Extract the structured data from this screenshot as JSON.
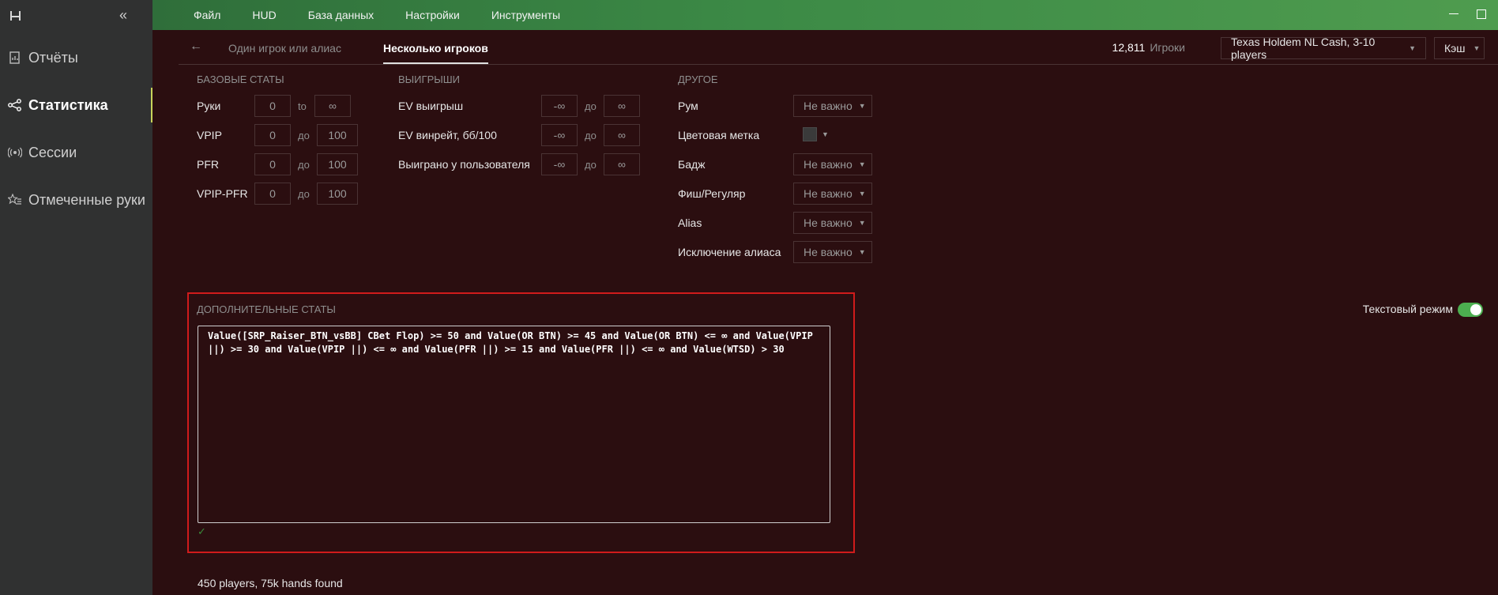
{
  "sidebar": {
    "logo_icon": "app-logo-icon",
    "collapse_icon": "chevrons-left-icon",
    "items": [
      {
        "label": "Отчёты",
        "icon": "report-icon"
      },
      {
        "label": "Статистика",
        "icon": "share-graph-icon"
      },
      {
        "label": "Сессии",
        "icon": "broadcast-icon"
      },
      {
        "label": "Отмеченные руки",
        "icon": "star-list-icon"
      }
    ]
  },
  "topbar": {
    "menu": [
      "Файл",
      "HUD",
      "База данных",
      "Настройки",
      "Инструменты"
    ]
  },
  "tabs": {
    "inactive": "Один игрок или алиас",
    "active": "Несколько игроков"
  },
  "header": {
    "count": "12,811",
    "count_label": "Игроки",
    "game_type": "Texas Holdem NL Cash, 3-10 players",
    "cash": "Кэш"
  },
  "basic_stats": {
    "title": "Базовые статы",
    "rows": [
      {
        "label": "Руки",
        "min": "0",
        "sep": "to",
        "max": "∞"
      },
      {
        "label": "VPIP",
        "min": "0",
        "sep": "до",
        "max": "100"
      },
      {
        "label": "PFR",
        "min": "0",
        "sep": "до",
        "max": "100"
      },
      {
        "label": "VPIP-PFR",
        "min": "0",
        "sep": "до",
        "max": "100"
      }
    ]
  },
  "winnings": {
    "title": "Выигрыши",
    "rows": [
      {
        "label": "EV выигрыш",
        "min": "-∞",
        "sep": "до",
        "max": "∞"
      },
      {
        "label": "EV винрейт, бб/100",
        "min": "-∞",
        "sep": "до",
        "max": "∞"
      },
      {
        "label": "Выиграно у пользователя",
        "min": "-∞",
        "sep": "до",
        "max": "∞"
      }
    ]
  },
  "other": {
    "title": "Другое",
    "rows": [
      {
        "label": "Рум",
        "value": "Не важно"
      },
      {
        "label": "Цветовая метка",
        "value": ""
      },
      {
        "label": "Бадж",
        "value": "Не важно"
      },
      {
        "label": "Фиш/Регуляр",
        "value": "Не важно"
      },
      {
        "label": "Alias",
        "value": "Не важно"
      },
      {
        "label": "Исключение алиаса",
        "value": "Не важно"
      }
    ]
  },
  "extra": {
    "title": "Дополнительные статы",
    "expression": "Value([SRP_Raiser_BTN_vsBB] CBet Flop) >= 50 and Value(OR BTN) >= 45 and Value(OR BTN) <= ∞ and Value(VPIP ||) >= 30 and Value(VPIP ||) <= ∞ and Value(PFR ||) >= 15 and Value(PFR ||) <= ∞ and Value(WTSD) > 30",
    "valid_icon": "checkmark-icon",
    "text_mode_label": "Текстовый режим",
    "text_mode_on": true
  },
  "result": "450 players, 75k hands found",
  "colors": {
    "accent": "#4caf50",
    "highlight_border": "#d01b1b",
    "active_indicator": "#c8d35a"
  }
}
